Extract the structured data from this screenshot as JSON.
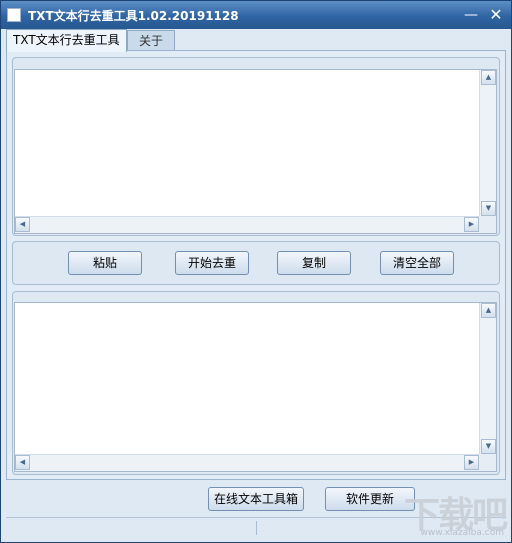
{
  "window": {
    "title": "TXT文本行去重工具1.02.20191128",
    "minimize_glyph": "—",
    "close_glyph": "✕"
  },
  "tabs": [
    {
      "label": "TXT文本行去重工具",
      "active": true
    },
    {
      "label": "关于",
      "active": false
    }
  ],
  "input_box": {
    "value": ""
  },
  "actions": {
    "paste": "粘贴",
    "start_dedupe": "开始去重",
    "copy": "复制",
    "clear_all": "清空全部"
  },
  "output_box": {
    "value": ""
  },
  "footer": {
    "online_toolbox": "在线文本工具箱",
    "software_update": "软件更新"
  },
  "scroll_glyphs": {
    "up": "▲",
    "down": "▼",
    "left": "◀",
    "right": "▶"
  },
  "watermark": {
    "text": "下载吧",
    "url": "www.xiazaiba.com"
  },
  "colors": {
    "title_bar": "#2f64a3",
    "window_bg": "#dfe9f4",
    "button_top": "#f2f6fb",
    "button_bottom": "#cddcec"
  }
}
